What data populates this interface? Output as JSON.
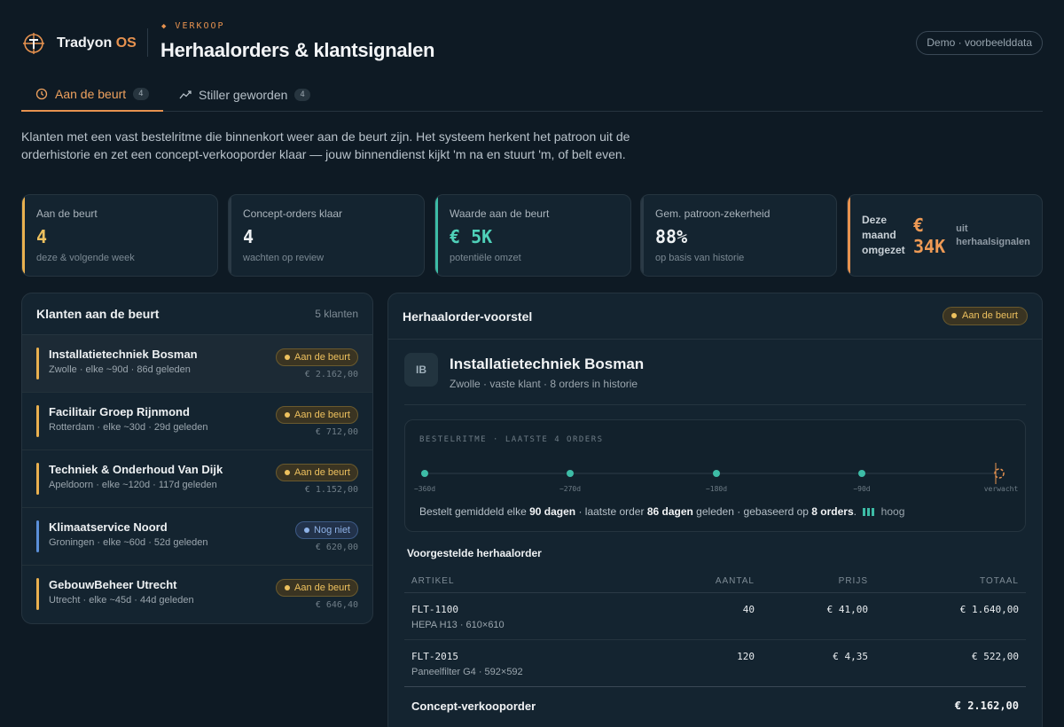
{
  "brand": {
    "name": "Tradyon",
    "suffix": "OS"
  },
  "header": {
    "eyebrow": "VERKOOP",
    "title": "Herhaalorders & klantsignalen",
    "demo_label": "Demo · voorbeelddata"
  },
  "tabs": [
    {
      "label": "Aan de beurt",
      "count": "4",
      "icon": "clock-icon",
      "active": true
    },
    {
      "label": "Stiller geworden",
      "count": "4",
      "icon": "trend-icon",
      "active": false
    }
  ],
  "intro": "Klanten met een vast bestelritme die binnenkort weer aan de beurt zijn. Het systeem herkent het patroon uit de orderhistorie en zet een concept-verkooporder klaar — jouw binnendienst kijkt 'm na en stuurt 'm, of belt even.",
  "kpis": [
    {
      "label": "Aan de beurt",
      "value": "4",
      "sub": "deze & volgende week",
      "color": "#e9b04f"
    },
    {
      "label": "Concept-orders klaar",
      "value": "4",
      "sub": "wachten op review",
      "color": "#2b3a46"
    },
    {
      "label": "Waarde aan de beurt",
      "value": "€ 5K",
      "sub": "potentiële omzet",
      "color": "#3dbca6"
    },
    {
      "label": "Gem. patroon-zekerheid",
      "value": "88%",
      "sub": "op basis van historie",
      "color": "#2b3a46"
    }
  ],
  "kpi_month": {
    "label": "Deze maand omgezet",
    "value": "€ 34K",
    "sub": "uit herhaalsignalen",
    "color": "#e7924f"
  },
  "list": {
    "title": "Klanten aan de beurt",
    "count": "5 klanten",
    "rows": [
      {
        "name": "Installatietechniek Bosman",
        "meta": "Zwolle · elke ~90d · 86d geleden",
        "badge": "Aan de beurt",
        "amount": "€ 2.162,00",
        "status": "warn"
      },
      {
        "name": "Facilitair Groep Rijnmond",
        "meta": "Rotterdam · elke ~30d · 29d geleden",
        "badge": "Aan de beurt",
        "amount": "€ 712,00",
        "status": "warn"
      },
      {
        "name": "Techniek & Onderhoud Van Dijk",
        "meta": "Apeldoorn · elke ~120d · 117d geleden",
        "badge": "Aan de beurt",
        "amount": "€ 1.152,00",
        "status": "warn"
      },
      {
        "name": "Klimaatservice Noord",
        "meta": "Groningen · elke ~60d · 52d geleden",
        "badge": "Nog niet",
        "amount": "€ 620,00",
        "status": "info"
      },
      {
        "name": "GebouwBeheer Utrecht",
        "meta": "Utrecht · elke ~45d · 44d geleden",
        "badge": "Aan de beurt",
        "amount": "€ 646,40",
        "status": "warn"
      }
    ]
  },
  "detail": {
    "title": "Herhaalorder-voorstel",
    "status": "Aan de beurt",
    "customer": {
      "initials": "IB",
      "name": "Installatietechniek Bosman",
      "desc": "Zwolle · vaste klant · 8 orders in historie"
    },
    "rhythm": {
      "caption": "BESTELRITME · LAATSTE 4 ORDERS",
      "points": [
        "−360d",
        "−270d",
        "−180d",
        "−90d"
      ],
      "expected_label": "verwacht",
      "s1": "Bestelt gemiddeld elke ",
      "avg": "90 dagen",
      "s2": " · laatste order ",
      "last": "86 dagen",
      "s3": " geleden · gebaseerd op ",
      "orders": "8 orders",
      "s4": ".",
      "confidence": "hoog"
    },
    "suggestion_title": "Voorgestelde herhaalorder",
    "columns": {
      "article": "ARTIKEL",
      "qty": "AANTAL",
      "price": "PRIJS",
      "total": "TOTAAL"
    },
    "lines": [
      {
        "code": "FLT-1100",
        "desc": "HEPA H13 · 610×610",
        "qty": "40",
        "price": "€ 41,00",
        "total": "€ 1.640,00"
      },
      {
        "code": "FLT-2015",
        "desc": "Paneelfilter G4 · 592×592",
        "qty": "120",
        "price": "€ 4,35",
        "total": "€ 522,00"
      }
    ],
    "total_label": "Concept-verkooporder",
    "total_value": "€ 2.162,00"
  }
}
